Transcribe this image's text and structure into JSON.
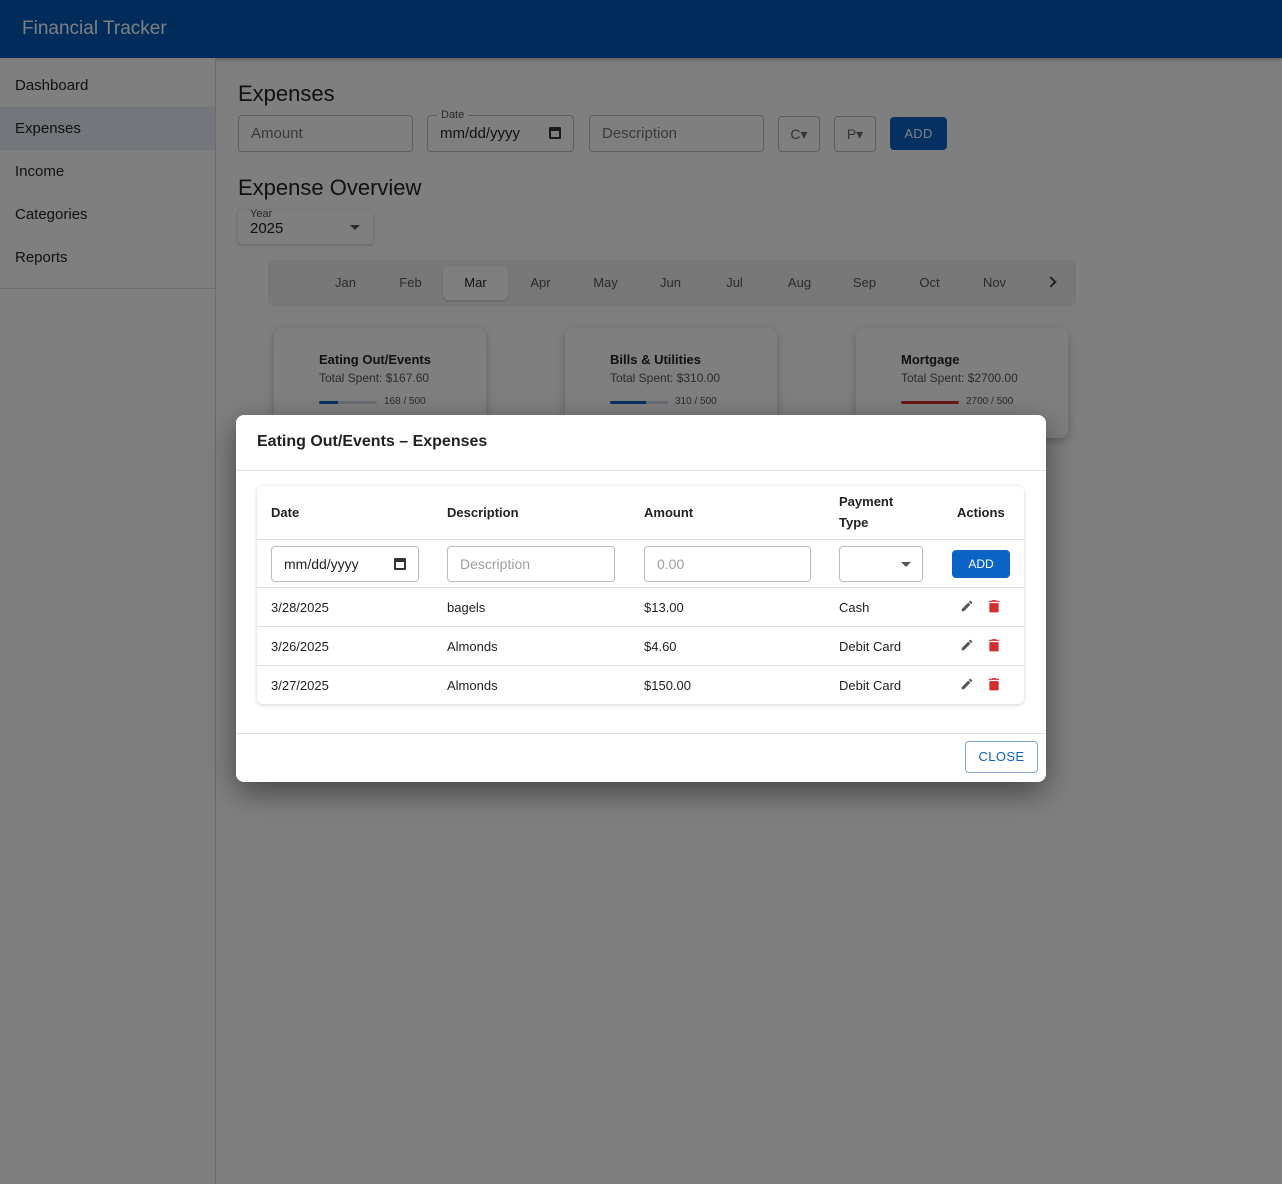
{
  "app": {
    "title": "Financial Tracker"
  },
  "sidebar": {
    "items": [
      {
        "label": "Dashboard"
      },
      {
        "label": "Expenses"
      },
      {
        "label": "Income"
      },
      {
        "label": "Categories"
      },
      {
        "label": "Reports"
      }
    ],
    "active": "Expenses"
  },
  "expense_form": {
    "heading": "Expenses",
    "amount_placeholder": "Amount",
    "date_label": "Date",
    "date_placeholder": "mm/dd/yyyy",
    "description_placeholder": "Description",
    "category_button": "C▾",
    "payment_button": "P▾",
    "add_label": "ADD"
  },
  "overview": {
    "heading": "Expense Overview",
    "year_label": "Year",
    "year_value": "2025",
    "months": [
      "Jan",
      "Feb",
      "Mar",
      "Apr",
      "May",
      "Jun",
      "Jul",
      "Aug",
      "Sep",
      "Oct",
      "Nov"
    ],
    "active_month": "Mar"
  },
  "categories": [
    {
      "name": "Eating Out/Events",
      "total": "Total Spent: $167.60",
      "progress_label": "168 / 500",
      "progress": 0.336,
      "status_color": "#0b63c5"
    },
    {
      "name": "Bills & Utilities",
      "total": "Total Spent: $310.00",
      "progress_label": "310 / 500",
      "progress": 0.62,
      "status_color": "#0b63c5"
    },
    {
      "name": "Mortgage",
      "total": "Total Spent: $2700.00",
      "progress_label": "2700 / 500",
      "progress": 1.0,
      "status_color": "#d32f2f"
    }
  ],
  "dialog": {
    "title": "Eating Out/Events – Expenses",
    "columns": {
      "date": "Date",
      "description": "Description",
      "amount": "Amount",
      "payment_line1": "Payment",
      "payment_line2": "Type",
      "actions": "Actions"
    },
    "new_row": {
      "date_placeholder": "mm/dd/yyyy",
      "description_placeholder": "Description",
      "amount_placeholder": "0.00",
      "add_label": "ADD"
    },
    "rows": [
      {
        "date": "3/28/2025",
        "description": "bagels",
        "amount": "$13.00",
        "payment": "Cash"
      },
      {
        "date": "3/26/2025",
        "description": "Almonds",
        "amount": "$4.60",
        "payment": "Debit Card"
      },
      {
        "date": "3/27/2025",
        "description": "Almonds",
        "amount": "$150.00",
        "payment": "Debit Card"
      }
    ],
    "close_label": "CLOSE"
  },
  "colors": {
    "primary": "#0b63c5",
    "appbar": "#0058b8",
    "danger": "#d32f2f"
  }
}
